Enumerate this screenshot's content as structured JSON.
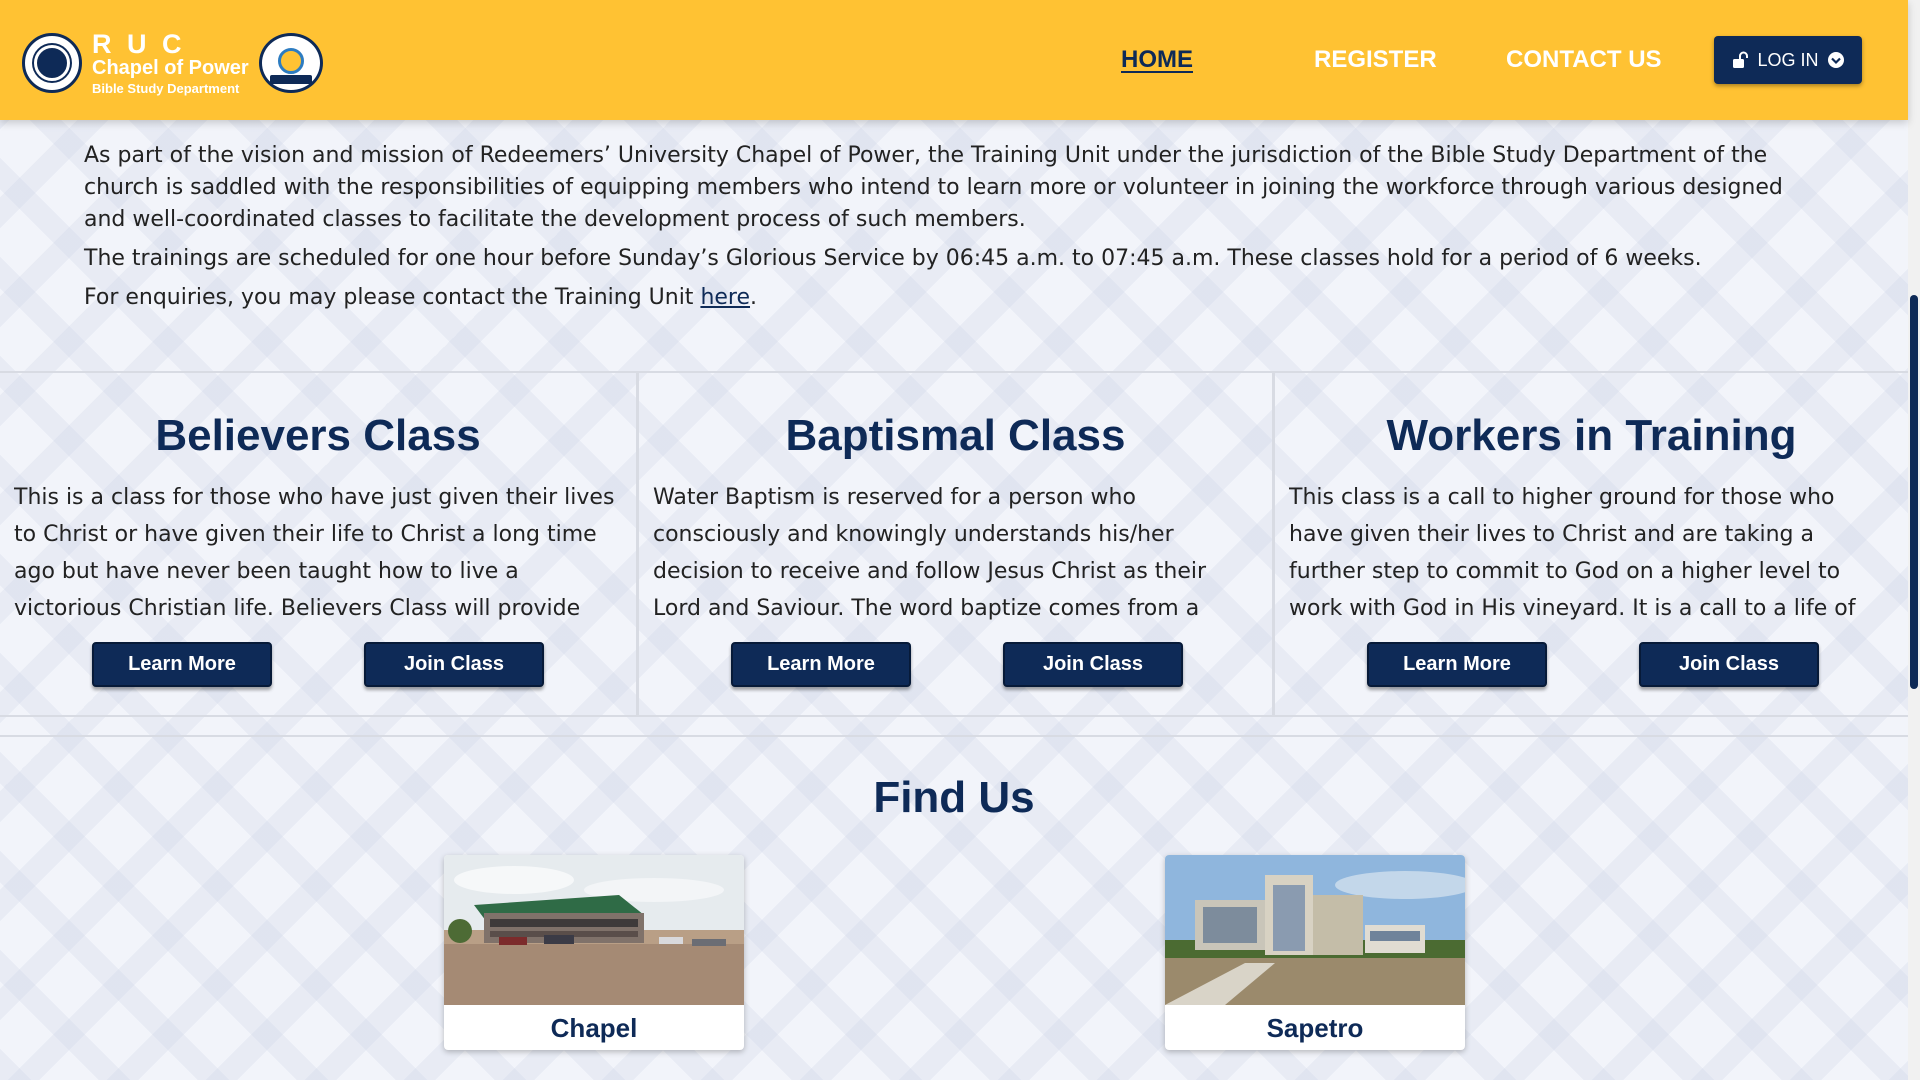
{
  "header": {
    "brand": {
      "main": "R U C",
      "sub": "Chapel of Power",
      "dept": "Bible Study Department"
    },
    "nav": [
      {
        "label": "HOME",
        "active": true
      },
      {
        "label": "REGISTER",
        "active": false
      },
      {
        "label": "CONTACT US",
        "active": false
      }
    ],
    "login_label": "LOG IN"
  },
  "intro": {
    "p1": "As part of the vision and mission of Redeemers’ University Chapel of Power, the Training Unit under the jurisdiction of the Bible Study Department of the church is saddled with the responsibilities of equipping members who intend to learn more or volunteer in joining the workforce through various designed and well-coordinated classes to facilitate the development process of such members.",
    "p2": "The trainings are scheduled for one hour before Sunday’s Glorious Service by 06:45 a.m. to 07:45 a.m. These classes hold for a period of 6 weeks.",
    "p3_prefix": "For enquiries, you may please contact the Training Unit ",
    "p3_link": "here",
    "p3_suffix": "."
  },
  "classes": [
    {
      "title": "Believers Class",
      "description": "This is a class for those who have just given their lives to Christ or have given their life to Christ a long time ago but have never been taught how to live a victorious Christian life. Believers Class will provide you with the",
      "learn_more": "Learn More",
      "join": "Join Class"
    },
    {
      "title": "Baptismal Class",
      "description": "Water Baptism is reserved for a person who consciously and knowingly understands his/her decision to receive and follow Jesus Christ as their Lord and Saviour. The word baptize comes from a Greek word \"baptizo\", which",
      "learn_more": "Learn More",
      "join": "Join Class"
    },
    {
      "title": "Workers in Training",
      "description": "This class is a call to higher ground for those who have given their lives to Christ and are taking a further step to commit to God on a higher level to work with God in His vineyard. It is a call to a life of loyalty to the Lord. It",
      "learn_more": "Learn More",
      "join": "Join Class"
    }
  ],
  "find_us": {
    "title": "Find Us",
    "locations": [
      {
        "name": "Chapel"
      },
      {
        "name": "Sapetro"
      }
    ]
  },
  "colors": {
    "header_bg": "#ffc233",
    "brand_navy": "#0e2a57",
    "page_bg": "#f2f4fa"
  },
  "icons": {
    "login": "lock-open-icon",
    "login_dropdown": "chevron-down-circle-icon"
  }
}
